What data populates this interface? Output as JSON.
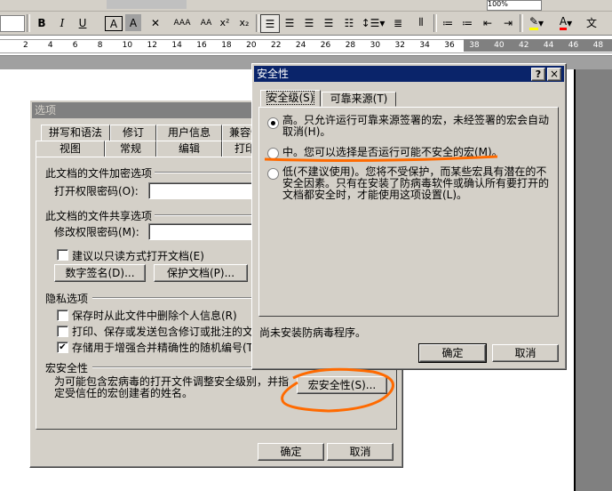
{
  "ruler": {
    "ticks": [
      "2",
      "4",
      "6",
      "8",
      "10",
      "12",
      "14",
      "16",
      "18",
      "20",
      "22",
      "24",
      "26",
      "28",
      "30",
      "32",
      "34",
      "36",
      "38",
      "40",
      "42",
      "44",
      "46",
      "48"
    ]
  },
  "toolbar": {
    "bold": "B",
    "italic": "I",
    "underline": "U",
    "char_border": "A",
    "char_shading": "A",
    "zoom_value": "100%",
    "superscript": "x²",
    "subscript": "x₂"
  },
  "options_dialog": {
    "title": "选项",
    "tabs_row1": [
      "拼写和语法",
      "修订",
      "用户信息",
      "兼容性"
    ],
    "tabs_row2": [
      "视图",
      "常规",
      "编辑",
      "打印"
    ],
    "encrypt_group": "此文档的文件加密选项",
    "open_password_label": "打开权限密码(O):",
    "share_group": "此文档的文件共享选项",
    "modify_password_label": "修改权限密码(M):",
    "readonly_recommend": "建议以只读方式打开文档(E)",
    "digital_sign_button": "数字签名(D)...",
    "protect_doc_button": "保护文档(P)...",
    "privacy_group": "隐私选项",
    "privacy_items": [
      {
        "label": "保存时从此文件中删除个人信息(R)",
        "checked": false
      },
      {
        "label": "打印、保存或发送包含修订或批注的文",
        "checked": false
      },
      {
        "label": "存储用于增强合并精确性的随机编号(T)",
        "checked": true
      }
    ],
    "security_group": "宏安全性",
    "security_desc": "为可能包含宏病毒的打开文件调整安全级别，并指定受信任的宏创建者的姓名。",
    "macro_security_button": "宏安全性(S)...",
    "ok": "确定",
    "cancel": "取消"
  },
  "security_dialog": {
    "title": "安全性",
    "help_button": "?",
    "close_button": "×",
    "tabs": [
      "安全级(S)",
      "可靠来源(T)"
    ],
    "options": [
      {
        "label": "高。只允许运行可靠来源签署的宏，未经签署的宏会自动取消(H)。",
        "selected": true
      },
      {
        "label": "中。您可以选择是否运行可能不安全的宏(M)。",
        "selected": false
      },
      {
        "label": "低(不建议使用)。您将不受保护，而某些宏具有潜在的不安全因素。只有在安装了防病毒软件或确认所有要打开的文档都安全时，才能使用这项设置(L)。",
        "selected": false
      }
    ],
    "antivirus_status": "尚未安装防病毒程序。",
    "ok": "确定",
    "cancel": "取消"
  },
  "colors": {
    "annotation": "#ff6a00",
    "titlebar_active": "#0a246a",
    "font_color_swatch": "#ff0000",
    "highlight_swatch": "#ffff00"
  }
}
